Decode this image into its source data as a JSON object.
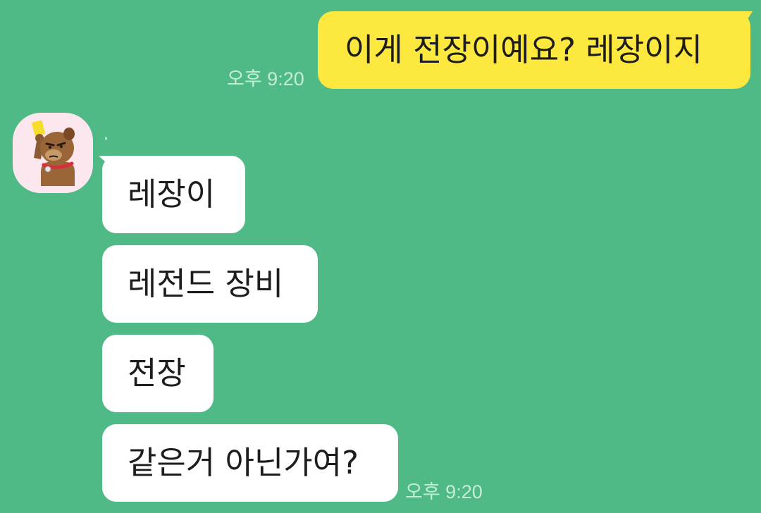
{
  "outgoing": {
    "text": "이게 전장이예요? 레장이지",
    "time": "오후 9:20"
  },
  "incoming": {
    "sender_name": ".",
    "avatar_icon": "brown-bear-yellow-card-avatar",
    "messages": [
      {
        "text": "레장이"
      },
      {
        "text": "레전드 장비"
      },
      {
        "text": "전장"
      },
      {
        "text": "같은거 아닌가여?"
      }
    ],
    "time": "오후 9:20"
  },
  "colors": {
    "background": "#4fba85",
    "outgoing_bubble": "#fce83f",
    "incoming_bubble": "#ffffff",
    "timestamp": "#c6ecd7",
    "avatar_bg": "#fde7ee"
  }
}
